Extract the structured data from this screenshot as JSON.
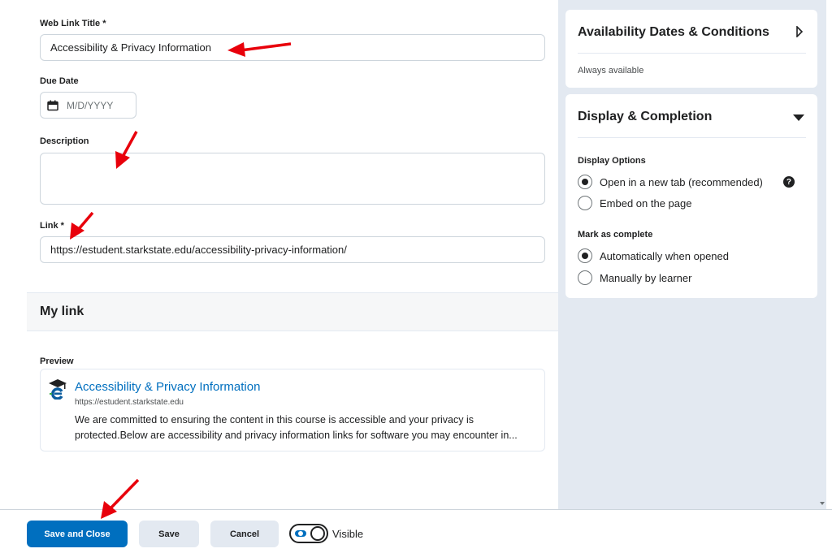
{
  "form": {
    "title_label": "Web Link Title *",
    "title_value": "Accessibility & Privacy Information",
    "due_label": "Due Date",
    "due_placeholder": "M/D/YYYY",
    "desc_label": "Description",
    "desc_value": "",
    "link_label": "Link *",
    "link_value": "https://estudent.starkstate.edu/accessibility-privacy-information/"
  },
  "mylink": {
    "heading": "My link",
    "preview_label": "Preview",
    "preview_title": "Accessibility & Privacy Information",
    "preview_url": "https://estudent.starkstate.edu",
    "preview_desc": "We are committed to ensuring the content in this course is accessible and your privacy is protected.Below are accessibility and privacy information links for software you may encounter in..."
  },
  "availability": {
    "heading": "Availability Dates & Conditions",
    "status": "Always available"
  },
  "display": {
    "heading": "Display & Completion",
    "options_label": "Display Options",
    "option_new_tab": "Open in a new tab (recommended)",
    "option_embed": "Embed on the page",
    "complete_label": "Mark as complete",
    "complete_auto": "Automatically when opened",
    "complete_manual": "Manually by learner",
    "selected_display": "new_tab",
    "selected_complete": "auto"
  },
  "footer": {
    "save_close": "Save and Close",
    "save": "Save",
    "cancel": "Cancel",
    "visible_label": "Visible",
    "visible": true
  },
  "colors": {
    "primary": "#006fbf",
    "annotation": "#e8000b",
    "panel_bg": "#e3e9f1"
  }
}
